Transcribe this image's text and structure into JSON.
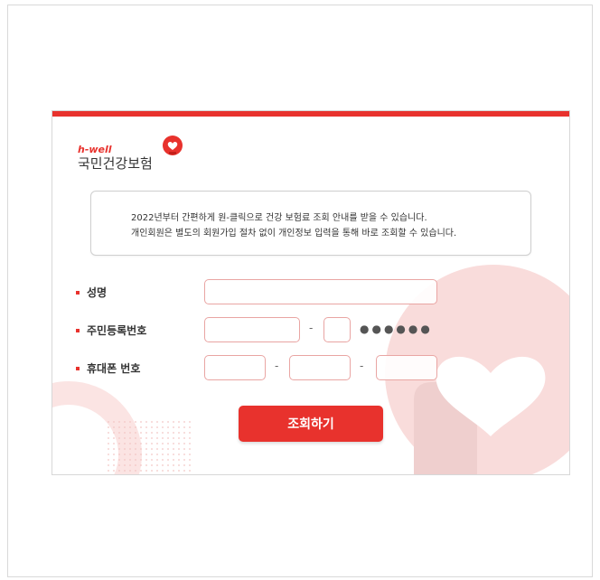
{
  "logo": {
    "brand_small": "h-well",
    "brand_main": "국민건강보험"
  },
  "notice": {
    "line1": "2022년부터 간편하게 원-클릭으로 건강 보험료 조회 안내를 받을 수 있습니다.",
    "line2": "개인회원은 별도의 회원가입 절차 없이 개인정보 입력을 통해 바로 조회할 수 있습니다."
  },
  "form": {
    "name_label": "성명",
    "rrn_label": "주민등록번호",
    "rrn_separator": "-",
    "rrn_mask": "●●●●●●",
    "phone_label": "휴대폰 번호",
    "phone_separator1": "-",
    "phone_separator2": "-",
    "name_value": "",
    "rrn_front_value": "",
    "rrn_back_first_value": "",
    "phone1_value": "",
    "phone2_value": "",
    "phone3_value": ""
  },
  "submit_label": "조회하기",
  "colors": {
    "accent": "#e8322d",
    "input_border": "#e9a5a3",
    "decor": "#f9dcdb"
  }
}
